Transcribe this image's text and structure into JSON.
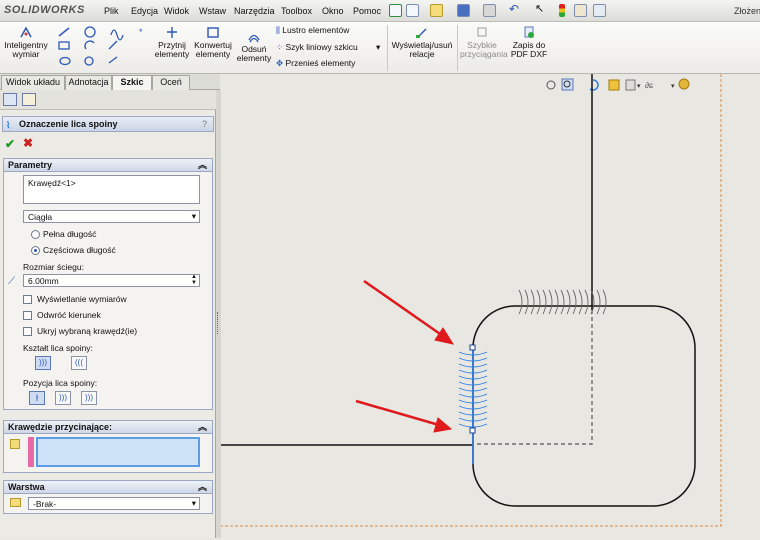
{
  "app": {
    "logo": "SOLIDWORKS",
    "right_text": "Złożen"
  },
  "menu": [
    "Plik",
    "Edycja",
    "Widok",
    "Wstaw",
    "Narzędzia",
    "Toolbox",
    "Okno",
    "Pomoc"
  ],
  "ribbon": {
    "smart_dimension": "Inteligentny\nwymiar",
    "trim": "Przytnij\nelementy",
    "convert": "Konwertuj\nelementy",
    "offset": "Odsuń\nelementy",
    "mirror": "Lustro elementów",
    "linear_pattern": "Szyk liniowy szkicu",
    "move": "Przenieś elementy",
    "display_relations": "Wyświetlaj/usuń\nrelacje",
    "quick_snaps": "Szybkie\nprzyciągania",
    "save_pdf": "Zapis do\nPDF DXF"
  },
  "tabs": [
    "Widok układu",
    "Adnotacja",
    "Szkic",
    "Oceń"
  ],
  "active_tab": "Szkic",
  "pm": {
    "title": "Oznaczenie lica spoiny",
    "params_header": "Parametry",
    "edge_value": "Krawędź<1>",
    "type_value": "Ciągła",
    "full_length": "Pełna długość",
    "partial_length": "Częściowa długość",
    "stitch_label": "Rozmiar ściegu:",
    "stitch_value": "6.00mm",
    "show_dims": "Wyświetlanie wymiarów",
    "reverse_dir": "Odwróć kierunek",
    "hide_edge": "Ukryj wybraną krawędź(ie)",
    "shape_label": "Kształt lica spoiny:",
    "position_label": "Pozycja lica spoiny:",
    "trim_header": "Krawędzie przycinające:",
    "layer_header": "Warstwa",
    "layer_value": "-Brak-"
  },
  "colors": {
    "weld": "#2b7de0",
    "arrow": "#e0191d",
    "border_dash": "#e08a3a"
  }
}
